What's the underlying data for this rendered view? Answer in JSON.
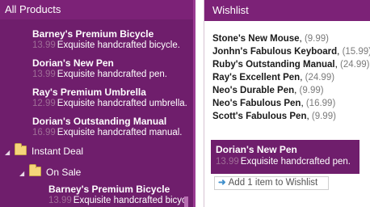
{
  "left_panel": {
    "title": "All Products",
    "products": [
      {
        "name": "Barney's Premium Bicycle",
        "price": "13.99",
        "desc": "Exquisite handcrafted bicycle."
      },
      {
        "name": "Dorian's New Pen",
        "price": "13.99",
        "desc": "Exquisite handcrafted pen."
      },
      {
        "name": "Ray's Premium Umbrella",
        "price": "12.99",
        "desc": "Exquisite handcrafted umbrella."
      },
      {
        "name": "Dorian's Outstanding Manual",
        "price": "16.99",
        "desc": "Exquisite handcrafted manual."
      }
    ],
    "tree": {
      "category": "Instant Deal",
      "subcategory": "On Sale",
      "sub_products": [
        {
          "name": "Barney's Premium Bicycle",
          "price": "13.99",
          "desc": "Exquisite handcrafted bicycle."
        }
      ]
    }
  },
  "right_panel": {
    "title": "Wishlist",
    "items": [
      {
        "name": "Stone's New Mouse",
        "price": "(9.99)"
      },
      {
        "name": "Jonhn's Fabulous Keyboard",
        "price": "(15.99)"
      },
      {
        "name": "Ruby's Outstanding Manual",
        "price": "(24.99)"
      },
      {
        "name": "Ray's Excellent Pen",
        "price": "(24.99)"
      },
      {
        "name": "Neo's Durable Pen",
        "price": "(9.99)"
      },
      {
        "name": "Neo's Fabulous Pen",
        "price": "(16.99)"
      },
      {
        "name": "Scott's Fabulous Pen",
        "price": "(9.99)"
      }
    ],
    "selected": {
      "name": "Dorian's New Pen",
      "price": "13.99",
      "desc": "Exquisite handcrafted pen."
    },
    "add_button_label": "Add 1 item to Wishlist"
  },
  "colors": {
    "accent": "#6f1e6c",
    "header": "#7c2277",
    "price_muted": "#9f6e97",
    "folder": "#f5d57a",
    "arrow": "#3f8fcc"
  },
  "icons": {
    "folder": "folder-icon",
    "expanded": "expanded-triangle-icon",
    "add": "arrow-right-icon"
  }
}
